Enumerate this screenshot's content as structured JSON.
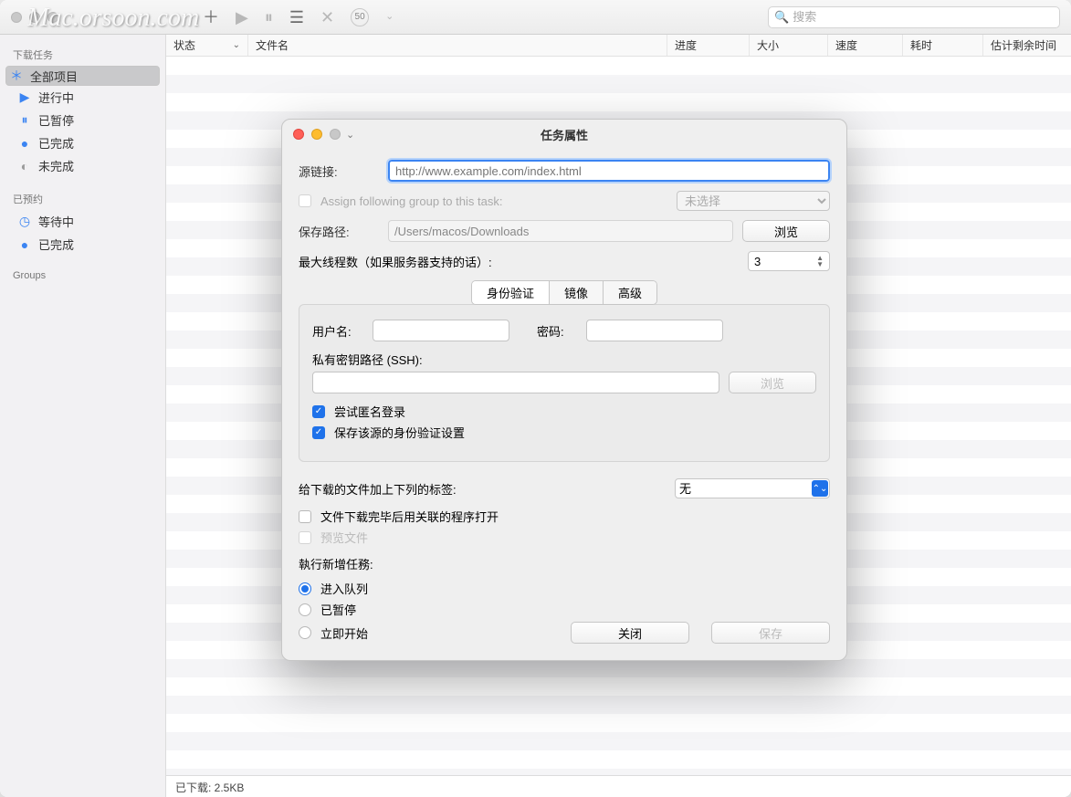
{
  "watermark": "Mac.orsoon.com",
  "toolbar": {
    "speed_value": "50",
    "search_placeholder": "搜索"
  },
  "sidebar": {
    "section_downloads": "下载任务",
    "items_downloads": [
      {
        "icon": "＊",
        "label": "全部项目",
        "selected": true,
        "iconColor": "blue"
      },
      {
        "icon": "▶",
        "label": "进行中",
        "iconColor": "blue"
      },
      {
        "icon": "⏸",
        "label": "已暂停",
        "iconColor": "blue"
      },
      {
        "icon": "●",
        "label": "已完成",
        "iconColor": "blue"
      },
      {
        "icon": "◐",
        "label": "未完成",
        "iconColor": "gray"
      }
    ],
    "section_scheduled": "已预约",
    "items_scheduled": [
      {
        "icon": "◷",
        "label": "等待中",
        "iconColor": "blue"
      },
      {
        "icon": "●",
        "label": "已完成",
        "iconColor": "blue"
      }
    ],
    "section_groups": "Groups"
  },
  "columns": {
    "status": "状态",
    "filename": "文件名",
    "progress": "进度",
    "size": "大小",
    "speed": "速度",
    "elapsed": "耗时",
    "eta": "估计剩余时间"
  },
  "statusbar": {
    "downloaded_label": "已下载:  2.5KB"
  },
  "modal": {
    "title": "任务属性",
    "source_label": "源链接:",
    "source_placeholder": "http://www.example.com/index.html",
    "assign_group_label": "Assign following group to this task:",
    "group_placeholder": "未选择",
    "save_path_label": "保存路径:",
    "save_path_value": "/Users/macos/Downloads",
    "browse": "浏览",
    "max_threads_label": "最大线程数（如果服务器支持的话）:",
    "max_threads_value": "3",
    "tabs": {
      "auth": "身份验证",
      "mirror": "镜像",
      "advanced": "高级"
    },
    "auth": {
      "username_label": "用户名:",
      "password_label": "密码:",
      "ssh_label": "私有密钥路径 (SSH):",
      "browse": "浏览",
      "anon_login": "尝试匿名登录",
      "save_auth": "保存该源的身份验证设置"
    },
    "tags_label": "给下载的文件加上下列的标签:",
    "tags_value": "无",
    "open_after_label": "文件下载完毕后用关联的程序打开",
    "preview_label": "预览文件",
    "exec_label": "執行新增任務:",
    "radios": {
      "queue": "进入队列",
      "paused": "已暂停",
      "start": "立即开始"
    },
    "close": "关闭",
    "save": "保存"
  }
}
